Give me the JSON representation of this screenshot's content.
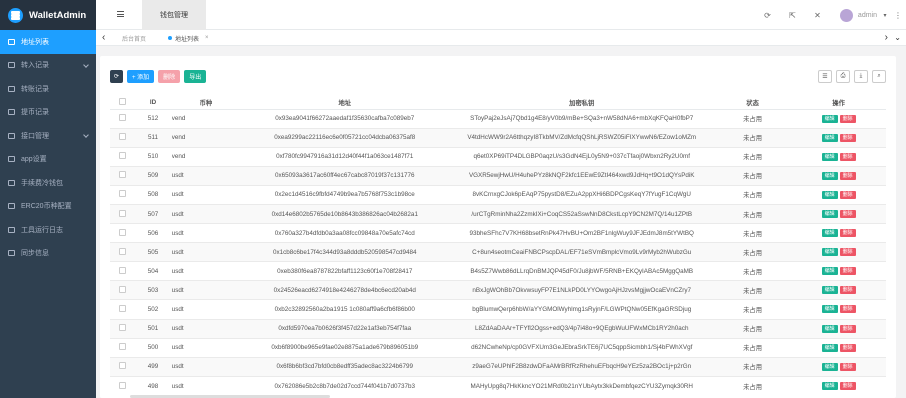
{
  "app": {
    "title": "WalletAdmin"
  },
  "sidebar": {
    "items": [
      {
        "label": "地址列表",
        "active": true,
        "chevron": false
      },
      {
        "label": "转入记录",
        "active": false,
        "chevron": true
      },
      {
        "label": "转账记录",
        "active": false,
        "chevron": false
      },
      {
        "label": "提币记录",
        "active": false,
        "chevron": false
      },
      {
        "label": "接口管理",
        "active": false,
        "chevron": true
      },
      {
        "label": "app设置",
        "active": false,
        "chevron": false
      },
      {
        "label": "手续费冷钱包",
        "active": false,
        "chevron": false
      },
      {
        "label": "ERC20币种配置",
        "active": false,
        "chevron": false
      },
      {
        "label": "工具运行日志",
        "active": false,
        "chevron": false
      },
      {
        "label": "同步信息",
        "active": false,
        "chevron": false
      }
    ]
  },
  "header": {
    "tab_label": "钱包管理",
    "user": "admin",
    "icons": [
      "refresh-icon",
      "fullscreen-icon",
      "close-icon"
    ]
  },
  "tabs": {
    "home": "后台首页",
    "current": "地址列表",
    "close": "×"
  },
  "toolbar": {
    "refresh": "⟳",
    "add": "+ 添加",
    "delete": "删除",
    "export": "导出"
  },
  "table": {
    "columns": [
      "ID",
      "币种",
      "地址",
      "加密私钥",
      "状态",
      "操作"
    ],
    "edit_label": "编辑",
    "delete_label": "删除",
    "rows": [
      {
        "id": "512",
        "coin": "vend",
        "address": "0x93ea9041f66272aaedaf1f35630cafba7c089eb7",
        "key": "SToyPaj2eJsAj7Qbd1g4E8/yV0b9/mBe+SQa3+nW58dNA6+mbXqKFQaH0fbP7",
        "status": "未占用"
      },
      {
        "id": "511",
        "coin": "vend",
        "address": "0xea9299ac22116ec6e0f05721cc04dcba06375af8",
        "key": "V4tdHcWW9r2A6tthqzyI8TkbMV/ZdMcfqQShLjRSWZ05iFIXYwwN6/EZow1oMZm",
        "status": "未占用"
      },
      {
        "id": "510",
        "coin": "vend",
        "address": "0xf780fc9947916a31d12d40f44f1a063ce1487f71",
        "key": "q6et0XP69iTP4DLGBP0aqzU/s3GdN4EjL0y5N9+037cTfaoj0Wbxn2Ry2U0mf",
        "status": "未占用"
      },
      {
        "id": "509",
        "coin": "usdt",
        "address": "0x65093a3617ac60ff4ec67cabc87019f37c131776",
        "key": "VGXR5ewjHwU/H4uhePYz8kNQF2kfc1EEwE9ZtI464xwd9JdHq+t9O1dQYsPdiK",
        "status": "未占用"
      },
      {
        "id": "508",
        "coin": "usdt",
        "address": "0x2ec1d4516c9fbfd4749b9ea7b5768f753c1b98ce",
        "key": "8vKCrnxgCJok6pEAqP75pystD8/EZuA2ppXHi6BDPCgsKeqY7fYugF1CqWgU",
        "status": "未占用"
      },
      {
        "id": "507",
        "coin": "usdt",
        "address": "0xd14e6802b5765de10b8643b386826ac04b2682a1",
        "key": "/urCTgRminNha2ZzmkIXi+CoqCS52aSswNnD8CkstLcpY9CN2M7Q/14u1ZPtB",
        "status": "未占用"
      },
      {
        "id": "506",
        "coin": "usdt",
        "address": "0x760a327b4dfdb0a3aa08fcc09848a70e5afc74cd",
        "key": "93bheSFhc7V7KH68bsetRnPk47HvBU+Om2BF1nlgWuy9JFJEdmJ8m5tYWtBQ",
        "status": "未占用"
      },
      {
        "id": "505",
        "coin": "usdt",
        "address": "0x1cb8c6be17f4c344d93a8dddb520598547cd9484",
        "key": "C+8un4seotmCeaiFNBCPscpDAL/EF71eSVmBmplcVmo9Lv9rMyb2hWubzGu",
        "status": "未占用"
      },
      {
        "id": "504",
        "coin": "usdt",
        "address": "0xeb380f6ea8787822bfaff1123c60f1e708f28417",
        "key": "B4s5Z7Wwb86dLLrqDnBMJQP45dF0/Ju8jbWF/5RNB+EKQyIABAc5MggQaMB",
        "status": "未占用"
      },
      {
        "id": "503",
        "coin": "usdt",
        "address": "0x24526eacd6274918e4246278de4bc6ecd20ab4d",
        "key": "nBxJgWOhBb7OkvwsuyFP7E1NLkPD0LYYOwgoAjHJzvsMgjjwOcaEVnCZry7",
        "status": "未占用"
      },
      {
        "id": "502",
        "coin": "usdt",
        "address": "0xb2c32892560a2ba1915 1c080aff9a6cfb6f86b00",
        "key": "bgBlumwQerp6hbW/aYYGMOlWyhlmg1sRyjnF/LGWPtQNw05EfKgaGRSDjug",
        "status": "未占用"
      },
      {
        "id": "501",
        "coin": "usdt",
        "address": "0xdfd5970ea7b0626f3f457d22e1af3eb754f7faa",
        "key": "L8ZdAaDAAr+TFYfl2Ogss+edQ3/4p7i48o+9QEgbWuUFWxMCb1RY2h0ach",
        "status": "未占用"
      },
      {
        "id": "500",
        "coin": "usdt",
        "address": "0xb6f8900be965e9fae02e8875a1ade679b896051b9",
        "key": "d62NCwheNp/cp0GVFXUm3GeJEbraSrkTE6j7UC5qppSicmbh1/Sj4bFWhXVgf",
        "status": "未占用"
      },
      {
        "id": "499",
        "coin": "usdt",
        "address": "0x6f8b6bf3cd7bfd0cb8edff35adec8ac3224b6799",
        "key": "z9aeG7eUPhlF2B8zdwDFaAMrBRfRzRhehuEFbqcH9eYEz5za2BOc1j+p2rGn",
        "status": "未占用"
      },
      {
        "id": "498",
        "coin": "usdt",
        "address": "0x762086e5b2c8b7de02d7ccd744f041b7d0737b3",
        "key": "MAHyUpg8q7HkKkncYO21MRd0b21nYUbAytx3kkDembfqezCYU3Zymqk30RH",
        "status": "未占用"
      }
    ]
  }
}
